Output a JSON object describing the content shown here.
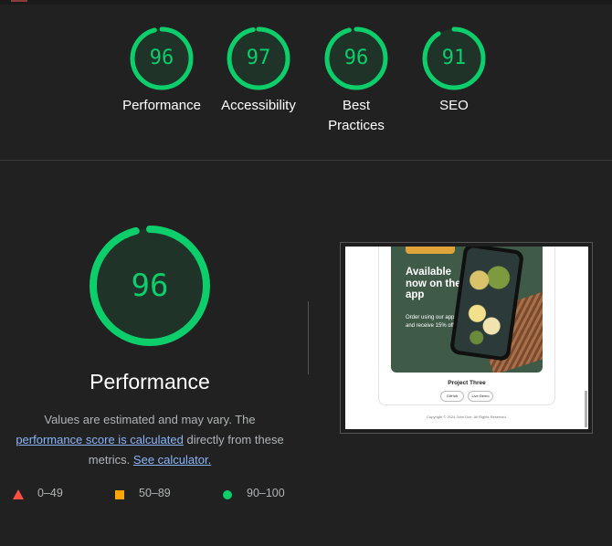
{
  "summary": {
    "gauges": [
      {
        "label": "Performance",
        "score": "96",
        "value": 96
      },
      {
        "label": "Accessibility",
        "score": "97",
        "value": 97
      },
      {
        "label": "Best Practices",
        "score": "96",
        "value": 96
      },
      {
        "label": "SEO",
        "score": "91",
        "value": 91
      }
    ]
  },
  "performance": {
    "score": "96",
    "value": 96,
    "title": "Performance",
    "desc_prefix": "Values are estimated and may vary. The",
    "score_link": "performance score is calculated",
    "desc_middle": "directly from these metrics.",
    "calc_link": "See calculator."
  },
  "legend": {
    "fail": "0–49",
    "average": "50–89",
    "pass": "90–100"
  },
  "colors": {
    "pass": "#0cce6b",
    "average": "#ffa400",
    "fail": "#ff4e42",
    "background": "#212121",
    "link": "#8ab4f8"
  },
  "screenshot": {
    "headline": "Available now on the app",
    "subtext": "Order using our app and receive 15% off.",
    "project_title": "Project Three",
    "btn_github": "GitHub",
    "btn_demo": "Live Demo",
    "copyright": "Copyright © 2024 John Doe. All Rights Reserved."
  }
}
